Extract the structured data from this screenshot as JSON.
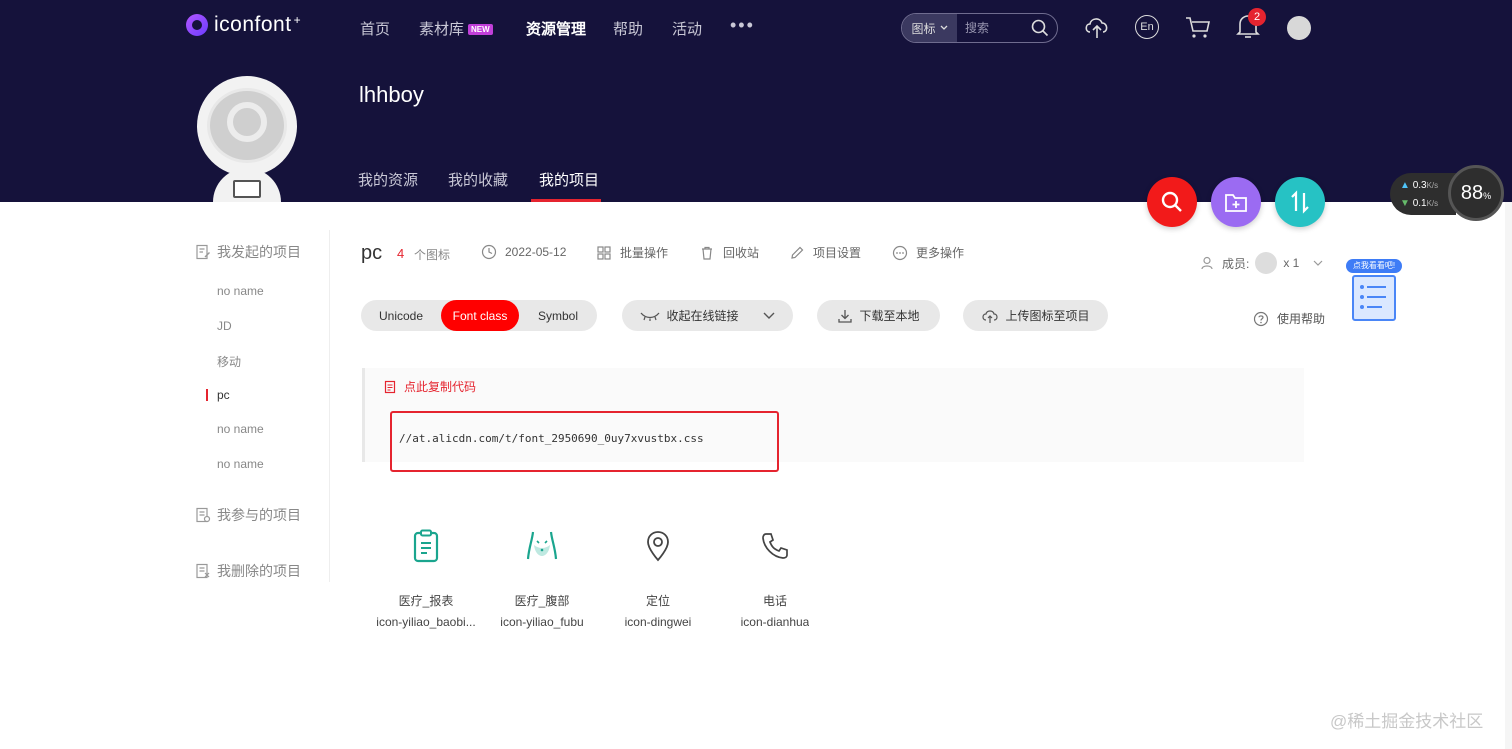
{
  "brand": {
    "name": "iconfont",
    "plus": "+"
  },
  "nav": {
    "items": [
      "首页",
      "素材库",
      "资源管理",
      "帮助",
      "活动"
    ],
    "new_badge": "NEW",
    "more": "•••"
  },
  "search": {
    "type": "图标",
    "placeholder": "搜索"
  },
  "notifications": {
    "count": "2"
  },
  "lang_icon": "En",
  "profile": {
    "username": "lhhboy",
    "tabs": [
      "我的资源",
      "我的收藏",
      "我的项目"
    ]
  },
  "speed": {
    "up": "0.3",
    "down": "0.1",
    "unit": "K/s",
    "percent": "88",
    "percent_sign": "%"
  },
  "sidebar": {
    "group_started": "我发起的项目",
    "projects": [
      "no name",
      "JD",
      "移动",
      "pc",
      "no name",
      "no name"
    ],
    "group_joined": "我参与的项目",
    "group_deleted": "我删除的项目"
  },
  "project": {
    "name": "pc",
    "count": "4",
    "count_label": "个图标",
    "date": "2022-05-12",
    "actions": [
      "批量操作",
      "回收站",
      "项目设置",
      "更多操作"
    ],
    "members_label": "成员:",
    "members_count": "x 1"
  },
  "toolbar": {
    "modes": [
      "Unicode",
      "Font class",
      "Symbol"
    ],
    "collapse_link": "收起在线链接",
    "download": "下载至本地",
    "upload": "上传图标至项目",
    "help": "使用帮助"
  },
  "help_widget": {
    "tag": "点我看看吧!"
  },
  "code": {
    "copy_label": "点此复制代码",
    "url": "//at.alicdn.com/t/font_2950690_0uy7xvustbx.css"
  },
  "icons": [
    {
      "name": "医疗_报表",
      "code": "icon-yiliao_baobi...",
      "icon": "report-icon"
    },
    {
      "name": "医疗_腹部",
      "code": "icon-yiliao_fubu",
      "icon": "abdomen-icon"
    },
    {
      "name": "定位",
      "code": "icon-dingwei",
      "icon": "location-icon"
    },
    {
      "name": "电话",
      "code": "icon-dianhua",
      "icon": "phone-icon"
    }
  ],
  "watermark": "@稀土掘金技术社区",
  "colors": {
    "header_bg": "#15123b",
    "accent": "#e5242f",
    "active_mode": "#ff0000"
  }
}
